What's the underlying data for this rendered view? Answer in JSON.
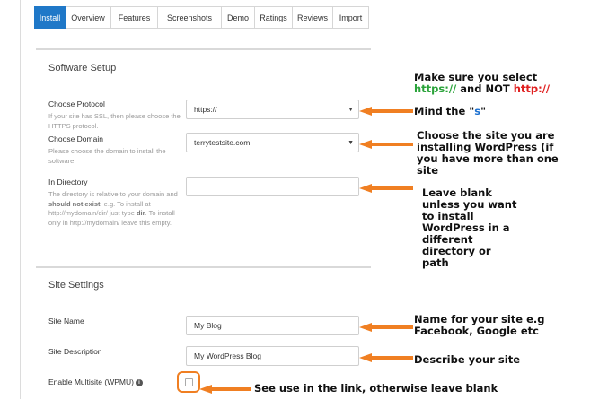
{
  "tabs": [
    {
      "label": "Install",
      "active": true
    },
    {
      "label": "Overview",
      "active": false
    },
    {
      "label": "Features",
      "active": false
    },
    {
      "label": "Screenshots",
      "active": false
    },
    {
      "label": "Demo",
      "active": false
    },
    {
      "label": "Ratings",
      "active": false
    },
    {
      "label": "Reviews",
      "active": false
    },
    {
      "label": "Import",
      "active": false
    }
  ],
  "software_setup": {
    "title": "Software Setup",
    "protocol": {
      "label": "Choose Protocol",
      "help": "If your site has SSL, then please choose the HTTPS protocol.",
      "value": "https://"
    },
    "domain": {
      "label": "Choose Domain",
      "help": "Please choose the domain to install the software.",
      "value": "terrytestsite.com"
    },
    "directory": {
      "label": "In Directory",
      "help_1": "The directory is relative to your domain and ",
      "help_bold_1": "should not exist",
      "help_2": ". e.g. To install at http://mydomain/dir/ just type ",
      "help_bold_2": "dir",
      "help_3": ". To install only in http://mydomain/ leave this empty.",
      "value": ""
    }
  },
  "site_settings": {
    "title": "Site Settings",
    "site_name": {
      "label": "Site Name",
      "value": "My Blog"
    },
    "site_description": {
      "label": "Site Description",
      "value": "My WordPress Blog"
    },
    "multisite": {
      "label": "Enable Multisite (WPMU)",
      "info_icon": "i",
      "checked": false
    }
  },
  "annotations": {
    "protocol_note_1": "Make sure you select",
    "protocol_https": "https://",
    "protocol_and_not": " and NOT ",
    "protocol_http": "http://",
    "mind_pre": "Mind the \"",
    "mind_s": "s",
    "mind_post": "\"",
    "domain_note": "Choose the site you are installing WordPress (if you have more than one site",
    "directory_note": "Leave blank unless you want to install WordPress in a different directory or path",
    "site_name_note": "Name for your site e.g Facebook, Google etc",
    "description_note": "Describe your site",
    "multisite_note": "See use in the link, otherwise leave blank"
  },
  "colors": {
    "accent": "#1f78c8",
    "arrow": "#f07f22",
    "green": "#2aa33a",
    "red": "#e02020"
  }
}
